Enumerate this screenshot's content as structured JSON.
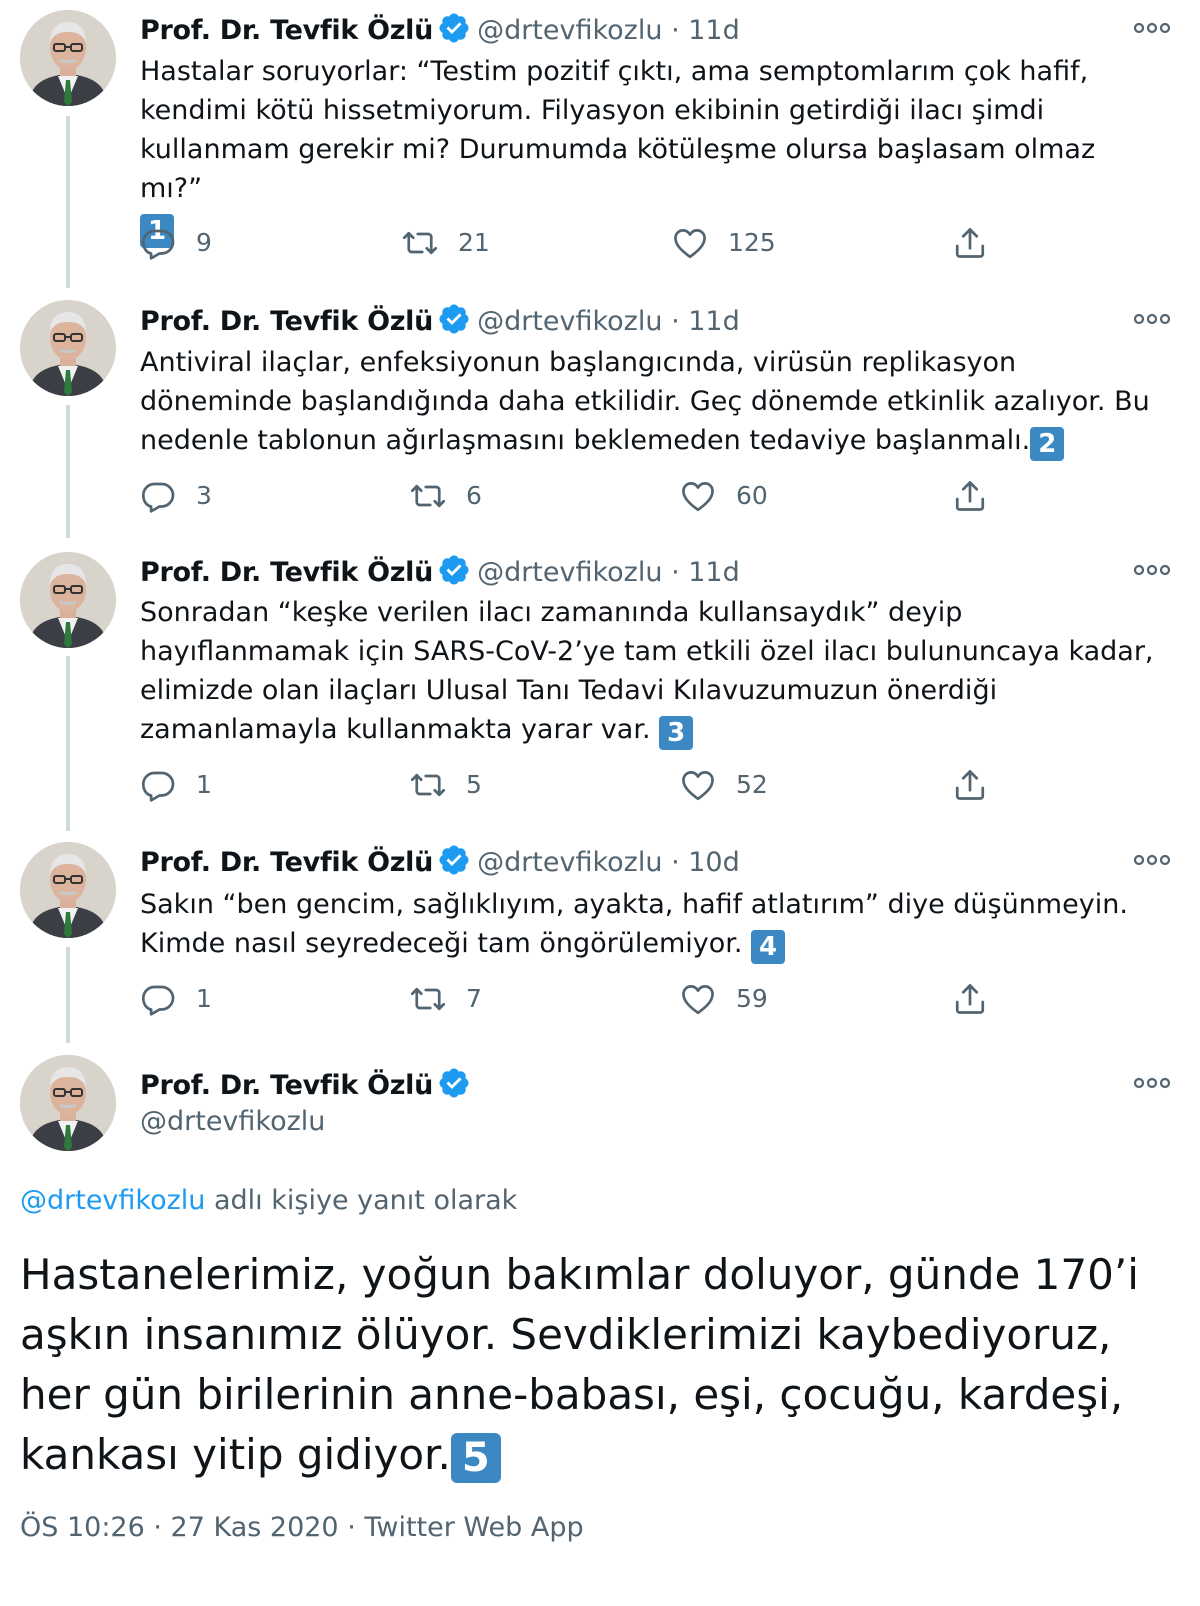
{
  "author": {
    "name": "Prof. Dr. Tevfik Özlü",
    "handle": "@drtevfikozlu"
  },
  "separator": "·",
  "tweets": [
    {
      "time": "11d",
      "text": "Hastalar soruyorlar: “Testim pozitif çıktı, ama semptomlarım çok hafif, kendimi kötü hissetmiyorum. Filyasyon ekibinin getirdiği ilacı şimdi kullanmam gerekir mi? Durumumda kötüleşme olursa başlasam olmaz mı?”",
      "badge": "1",
      "replies": "9",
      "retweets": "21",
      "likes": "125"
    },
    {
      "time": "11d",
      "text": "Antiviral ilaçlar, enfeksiyonun başlangıcında, virüsün replikasyon döneminde başlandığında daha etkilidir. Geç dönemde etkinlik azalıyor. Bu nedenle tablonun ağırlaşmasını beklemeden tedaviye başlanmalı.",
      "badge": "2",
      "replies": "3",
      "retweets": "6",
      "likes": "60"
    },
    {
      "time": "11d",
      "text": "Sonradan “keşke verilen ilacı zamanında kullansaydık” deyip hayıflanmamak için SARS-CoV-2’ye tam etkili özel ilacı bulununcaya kadar, elimizde olan ilaçları Ulusal Tanı Tedavi Kılavuzumuzun önerdiği zamanlamayla kullanmakta yarar var. ",
      "badge": "3",
      "replies": "1",
      "retweets": "5",
      "likes": "52"
    },
    {
      "time": "10d",
      "text": "Sakın “ben gencim, sağlıklıyım, ayakta, hafif atlatırım” diye düşünmeyin. Kimde nasıl seyredeceği tam öngörülemiyor. ",
      "badge": "4",
      "replies": "1",
      "retweets": "7",
      "likes": "59"
    }
  ],
  "main_tweet": {
    "reply_to_handle": "@drtevfikozlu",
    "reply_to_suffix": " adlı kişiye yanıt olarak",
    "text": "Hastanelerimiz, yoğun bakımlar doluyor, günde 170’i aşkın insanımız ölüyor. Sevdiklerimizi kaybediyoruz, her gün birilerinin anne-babası, eşi, çocuğu, kardeşi, kankası yitip gidiyor.",
    "badge": "5",
    "footer": "ÖS 10:26 · 27 Kas 2020 · Twitter Web App"
  },
  "colors": {
    "verified": "#1d9bf0",
    "badge": "#3b88c3",
    "muted": "#536471",
    "thread_line": "#cfd9de"
  },
  "icons": [
    "verified-icon",
    "more-icon",
    "reply-icon",
    "retweet-icon",
    "like-icon",
    "share-icon",
    "number-badge"
  ]
}
